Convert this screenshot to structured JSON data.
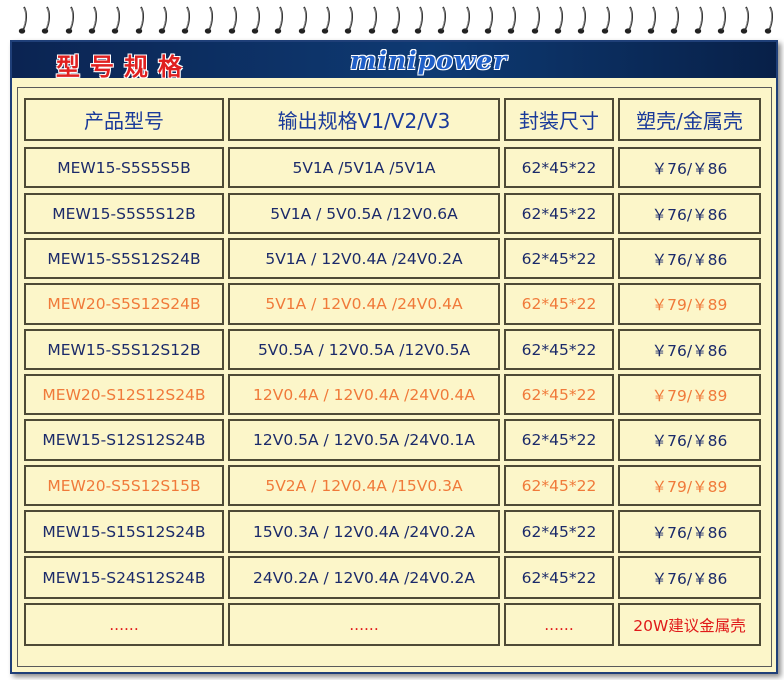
{
  "banner": {
    "title": "型号规格",
    "brand": "minipower"
  },
  "table": {
    "headers": [
      "产品型号",
      "输出规格V1/V2/V3",
      "封装尺寸",
      "塑壳/金属壳"
    ],
    "rows": [
      {
        "model": "MEW15-S5S5S5B",
        "output": "5V1A /5V1A /5V1A",
        "size": "62*45*22",
        "price": "￥76/￥86",
        "highlight": false
      },
      {
        "model": "MEW15-S5S5S12B",
        "output": "5V1A / 5V0.5A /12V0.6A",
        "size": "62*45*22",
        "price": "￥76/￥86",
        "highlight": false
      },
      {
        "model": "MEW15-S5S12S24B",
        "output": "5V1A / 12V0.4A /24V0.2A",
        "size": "62*45*22",
        "price": "￥76/￥86",
        "highlight": false
      },
      {
        "model": "MEW20-S5S12S24B",
        "output": "5V1A / 12V0.4A /24V0.4A",
        "size": "62*45*22",
        "price": "￥79/￥89",
        "highlight": true
      },
      {
        "model": "MEW15-S5S12S12B",
        "output": "5V0.5A / 12V0.5A /12V0.5A",
        "size": "62*45*22",
        "price": "￥76/￥86",
        "highlight": false
      },
      {
        "model": "MEW20-S12S12S24B",
        "output": "12V0.4A / 12V0.4A /24V0.4A",
        "size": "62*45*22",
        "price": "￥79/￥89",
        "highlight": true
      },
      {
        "model": "MEW15-S12S12S24B",
        "output": "12V0.5A / 12V0.5A /24V0.1A",
        "size": "62*45*22",
        "price": "￥76/￥86",
        "highlight": false
      },
      {
        "model": "MEW20-S5S12S15B",
        "output": "5V2A / 12V0.4A /15V0.3A",
        "size": "62*45*22",
        "price": "￥79/￥89",
        "highlight": true
      },
      {
        "model": "MEW15-S15S12S24B",
        "output": "15V0.3A / 12V0.4A /24V0.2A",
        "size": "62*45*22",
        "price": "￥76/￥86",
        "highlight": false
      },
      {
        "model": "MEW15-S24S12S24B",
        "output": "24V0.2A / 12V0.4A /24V0.2A",
        "size": "62*45*22",
        "price": "￥76/￥86",
        "highlight": false
      }
    ],
    "footer": {
      "model": "......",
      "output": "......",
      "size": "......",
      "note": "20W建议金属壳"
    }
  },
  "colors": {
    "panel_bg": "#fcf6c9",
    "banner_bg": "#0e3a73",
    "normal_text": "#1b2a6a",
    "highlight_text": "#f07a3a",
    "note_text": "#e01a1a"
  }
}
